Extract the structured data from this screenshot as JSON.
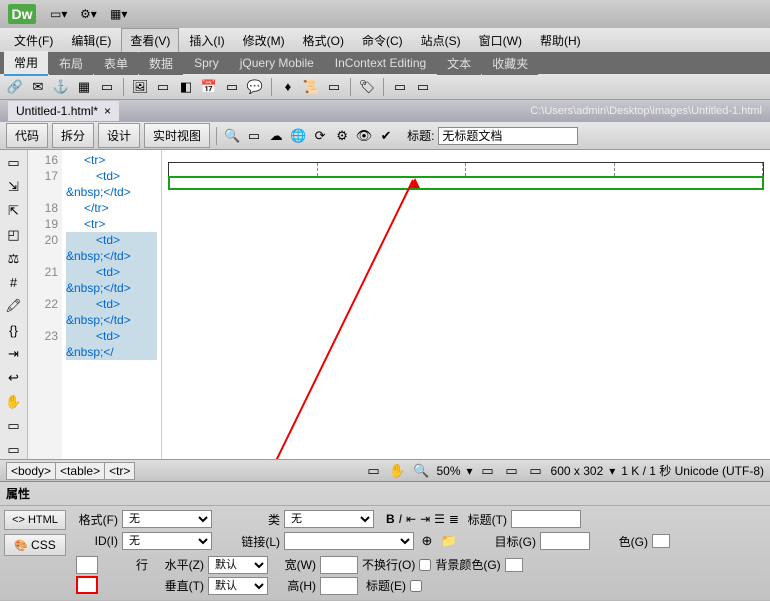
{
  "app": {
    "logo": "Dw"
  },
  "menu": {
    "file": "文件(F)",
    "edit": "编辑(E)",
    "view": "查看(V)",
    "insert": "插入(I)",
    "modify": "修改(M)",
    "format": "格式(O)",
    "commands": "命令(C)",
    "site": "站点(S)",
    "window": "窗口(W)",
    "help": "帮助(H)"
  },
  "insert_tabs": {
    "common": "常用",
    "layout": "布局",
    "forms": "表单",
    "data": "数据",
    "spry": "Spry",
    "jqm": "jQuery Mobile",
    "ice": "InContext Editing",
    "text": "文本",
    "fav": "收藏夹"
  },
  "doc": {
    "filename": "Untitled-1.html*",
    "close": "×",
    "path": "C:\\Users\\admin\\Desktop\\images\\Untitled-1.html"
  },
  "view": {
    "code": "代码",
    "split": "拆分",
    "design": "设计",
    "live": "实时视图",
    "title_label": "标题:",
    "title_value": "无标题文档"
  },
  "lines": {
    "l16": "16",
    "l17": "17",
    "l18": "18",
    "l19": "19",
    "l20": "20",
    "l21": "21",
    "l22": "22",
    "l23": "23"
  },
  "code": {
    "c1": "<tr>",
    "c2": "<td>",
    "c3": "&nbsp;</td>",
    "c4": "</tr>",
    "c5": "<tr>",
    "c6": "<td>",
    "c7": "&nbsp;</td>",
    "c8": "<td>",
    "c9": "&nbsp;</td>",
    "c10": "<td>",
    "c11": "&nbsp;</"
  },
  "status": {
    "body": "<body>",
    "table": "<table>",
    "tr": "<tr>",
    "zoom": "50%",
    "dims": "600 x 302",
    "size": "1 K / 1 秒 Unicode (UTF-8)"
  },
  "props": {
    "title": "属性",
    "html": "<> HTML",
    "css": "CSS",
    "format_l": "格式(F)",
    "format_v": "无",
    "id_l": "ID(I)",
    "id_v": "无",
    "class_l": "类",
    "class_v": "无",
    "link_l": "链接(L)",
    "title2_l": "标题(T)",
    "target_l": "目标(G)",
    "row_l": "行",
    "horz_l": "水平(Z)",
    "horz_v": "默认",
    "vert_l": "垂直(T)",
    "vert_v": "默认",
    "w_l": "宽(W)",
    "h_l": "高(H)",
    "nowrap_l": "不换行(O)",
    "header_l": "标题(E)",
    "bg_l": "背景颜色(G)",
    "color_l": "色(G)"
  }
}
